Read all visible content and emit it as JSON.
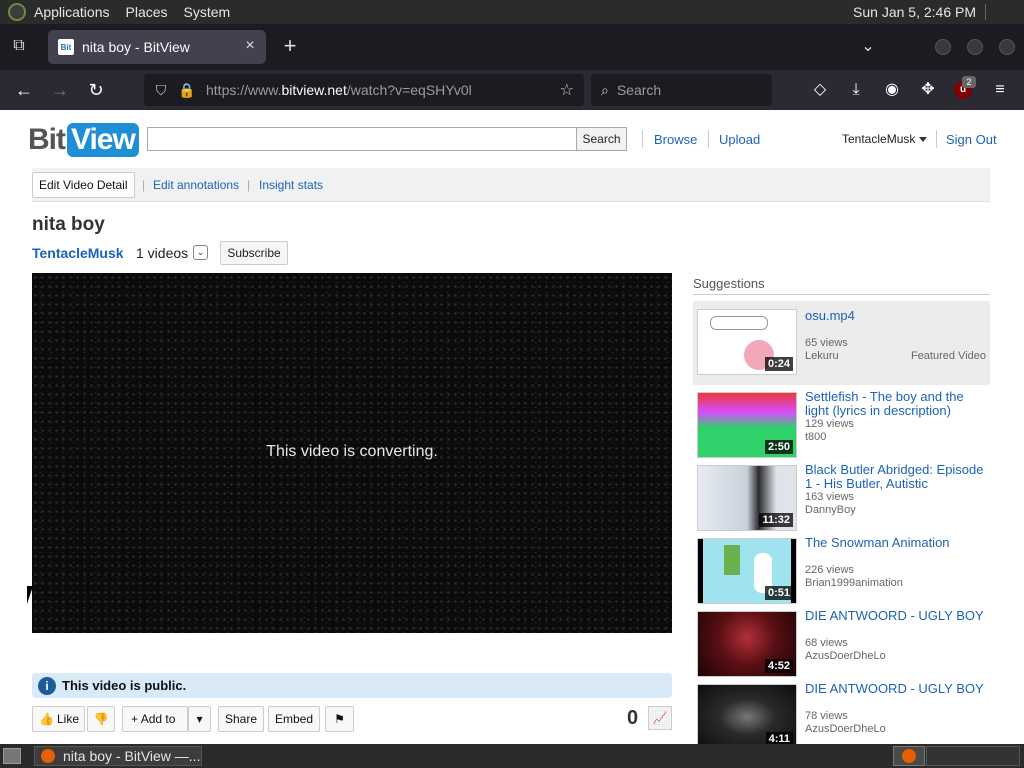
{
  "system_panel": {
    "menus": [
      "Applications",
      "Places",
      "System"
    ],
    "clock": "Sun Jan  5,  2:46 PM"
  },
  "browser": {
    "tab_title": "nita boy - BitView",
    "favicon_text": "Bit",
    "url_prefix": "https://www.",
    "url_domain": "bitview.net",
    "url_path": "/watch?v=eqSHYv0l",
    "search_placeholder": "Search",
    "ublock_badge": "2"
  },
  "site": {
    "logo_bit": "Bit",
    "logo_view": "View",
    "search_button": "Search",
    "nav": [
      "Browse",
      "Upload"
    ],
    "username": "TentacleMusk",
    "sign_out": "Sign Out",
    "subnav": {
      "edit_detail": "Edit Video Detail",
      "edit_annotations": "Edit annotations",
      "insight_stats": "Insight stats"
    }
  },
  "video": {
    "title": "nita boy",
    "channel": "TentacleMusk",
    "video_count": "1 videos",
    "subscribe": "Subscribe",
    "player_message": "This video is converting.",
    "public_notice": "This video is public.",
    "actions": {
      "like": "Like",
      "add_to": "Add to",
      "share": "Share",
      "embed": "Embed"
    },
    "views": "0"
  },
  "suggestions": {
    "heading": "Suggestions",
    "items": [
      {
        "title": "osu.mp4",
        "views": "65 views",
        "author": "Lekuru",
        "duration": "0:24",
        "featured_label": "Featured Video"
      },
      {
        "title": "Settlefish - The boy and the light (lyrics in description)",
        "views": "129 views",
        "author": "t800",
        "duration": "2:50"
      },
      {
        "title": "Black Butler Abridged: Episode 1 - His Butler, Autistic",
        "views": "163 views",
        "author": "DannyBoy",
        "duration": "11:32"
      },
      {
        "title": "The Snowman Animation",
        "views": "226 views",
        "author": "Brian1999animation",
        "duration": "0:51"
      },
      {
        "title": "DIE ANTWOORD - UGLY BOY",
        "views": "68 views",
        "author": "AzusDoerDheLo",
        "duration": "4:52"
      },
      {
        "title": "DIE ANTWOORD - UGLY BOY",
        "views": "78 views",
        "author": "AzusDoerDheLo",
        "duration": "4:11"
      }
    ]
  },
  "taskbar": {
    "task_label": "nita boy - BitView —..."
  }
}
